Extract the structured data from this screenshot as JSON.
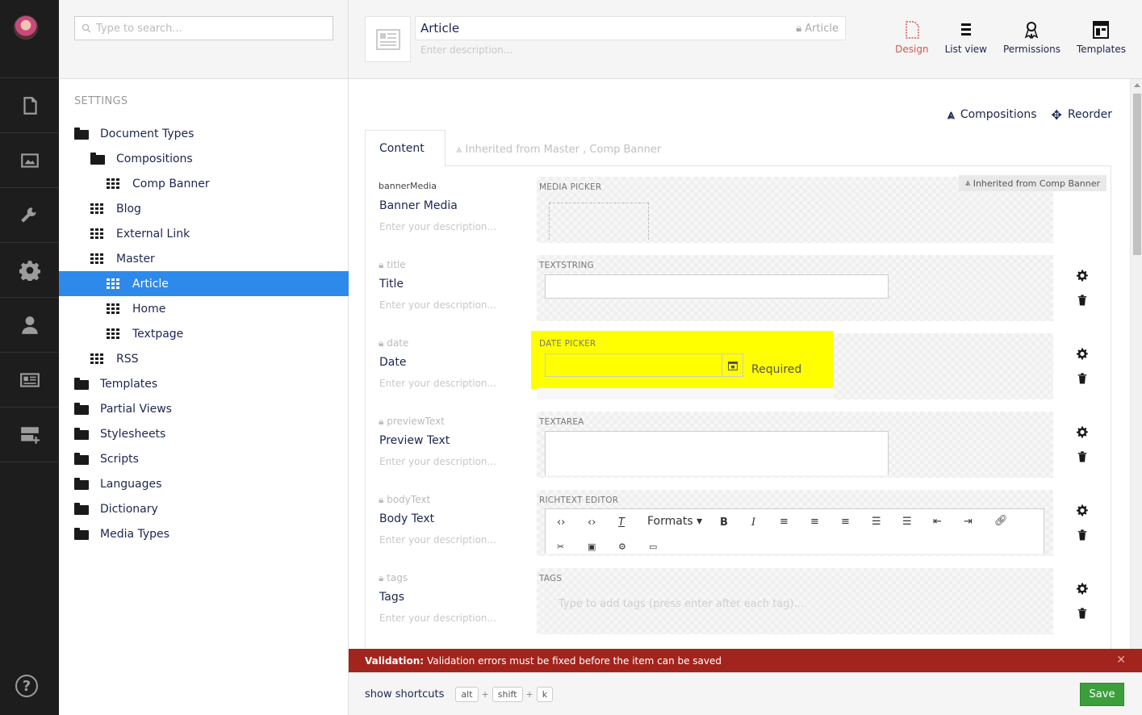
{
  "search": {
    "placeholder": "Type to search..."
  },
  "tree": {
    "heading": "SETTINGS",
    "items": [
      {
        "label": "Document Types",
        "kind": "folder",
        "indent": 0
      },
      {
        "label": "Compositions",
        "kind": "folder",
        "indent": 1
      },
      {
        "label": "Comp Banner",
        "kind": "doctype",
        "indent": 2
      },
      {
        "label": "Blog",
        "kind": "doctype",
        "indent": 1
      },
      {
        "label": "External Link",
        "kind": "doctype",
        "indent": 1
      },
      {
        "label": "Master",
        "kind": "doctype",
        "indent": 1
      },
      {
        "label": "Article",
        "kind": "doctype",
        "indent": 2,
        "active": true
      },
      {
        "label": "Home",
        "kind": "doctype",
        "indent": 2
      },
      {
        "label": "Textpage",
        "kind": "doctype",
        "indent": 2
      },
      {
        "label": "RSS",
        "kind": "doctype",
        "indent": 1
      },
      {
        "label": "Templates",
        "kind": "folder",
        "indent": 0
      },
      {
        "label": "Partial Views",
        "kind": "folder",
        "indent": 0
      },
      {
        "label": "Stylesheets",
        "kind": "folder",
        "indent": 0
      },
      {
        "label": "Scripts",
        "kind": "folder",
        "indent": 0
      },
      {
        "label": "Languages",
        "kind": "folder",
        "indent": 0
      },
      {
        "label": "Dictionary",
        "kind": "folder",
        "indent": 0
      },
      {
        "label": "Media Types",
        "kind": "folder",
        "indent": 0
      }
    ]
  },
  "header": {
    "name": "Article",
    "alias": "Article",
    "description_placeholder": "Enter description...",
    "apps": [
      {
        "label": "Design",
        "icon": "design-icon",
        "active": true
      },
      {
        "label": "List view",
        "icon": "list-icon"
      },
      {
        "label": "Permissions",
        "icon": "permissions-icon"
      },
      {
        "label": "Templates",
        "icon": "templates-icon"
      }
    ]
  },
  "toolbar": {
    "compositions": "Compositions",
    "reorder": "Reorder"
  },
  "tabs": {
    "active": "Content",
    "inherited": "Inherited from Master , Comp Banner"
  },
  "inherited_badge": "Inherited from Comp Banner",
  "properties": [
    {
      "alias": "bannerMedia",
      "label": "Banner Media",
      "desc": "Enter your description...",
      "editor": "MEDIA PICKER",
      "locked": false
    },
    {
      "alias": "title",
      "label": "Title",
      "desc": "Enter your description...",
      "editor": "TEXTSTRING",
      "locked": true
    },
    {
      "alias": "date",
      "label": "Date",
      "desc": "Enter your description...",
      "editor": "DATE PICKER",
      "locked": true,
      "required": "Required"
    },
    {
      "alias": "previewText",
      "label": "Preview Text",
      "desc": "Enter your description...",
      "editor": "TEXTAREA",
      "locked": true
    },
    {
      "alias": "bodyText",
      "label": "Body Text",
      "desc": "Enter your description...",
      "editor": "RICHTEXT EDITOR",
      "locked": true
    },
    {
      "alias": "tags",
      "label": "Tags",
      "desc": "Enter your description...",
      "editor": "TAGS",
      "locked": true,
      "placeholder": "Type to add tags (press enter after each tag)..."
    }
  ],
  "rte": {
    "formats": "Formats"
  },
  "validation": {
    "title": "Validation:",
    "message": "Validation errors must be fixed before the item can be saved"
  },
  "footer": {
    "shortcuts": "show shortcuts",
    "keys": [
      "alt",
      "shift",
      "k"
    ],
    "save": "Save"
  },
  "colors": {
    "accent": "#2e8aea",
    "danger": "#a2241c",
    "save": "#3c9f3c",
    "highlight": "#ffff00"
  }
}
